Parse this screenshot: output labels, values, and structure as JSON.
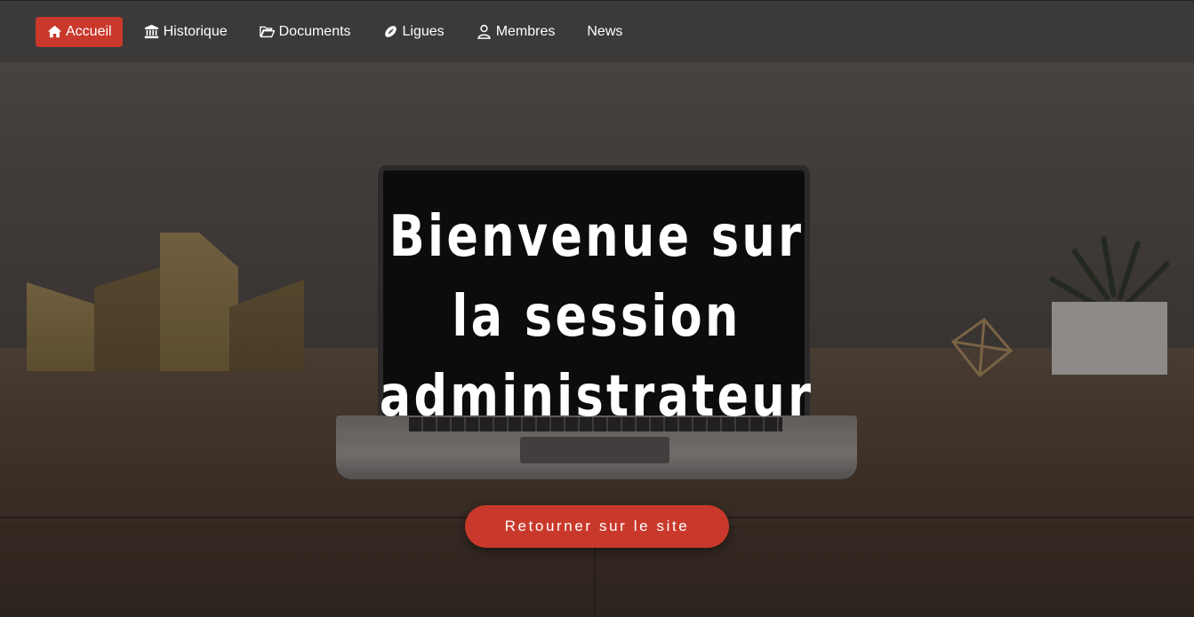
{
  "nav": {
    "items": [
      {
        "label": "Accueil",
        "icon": "home-icon",
        "active": true
      },
      {
        "label": "Historique",
        "icon": "bank-icon",
        "active": false
      },
      {
        "label": "Documents",
        "icon": "folder-open-icon",
        "active": false
      },
      {
        "label": "Ligues",
        "icon": "football-icon",
        "active": false
      },
      {
        "label": "Membres",
        "icon": "user-icon",
        "active": false
      },
      {
        "label": "News",
        "icon": "",
        "active": false
      }
    ]
  },
  "hero": {
    "title": "Bienvenue sur la session administrateur",
    "button_label": "Retourner sur le site"
  },
  "colors": {
    "accent": "#c9392b",
    "navbar": "#3b3a39",
    "text": "#ffffff"
  }
}
